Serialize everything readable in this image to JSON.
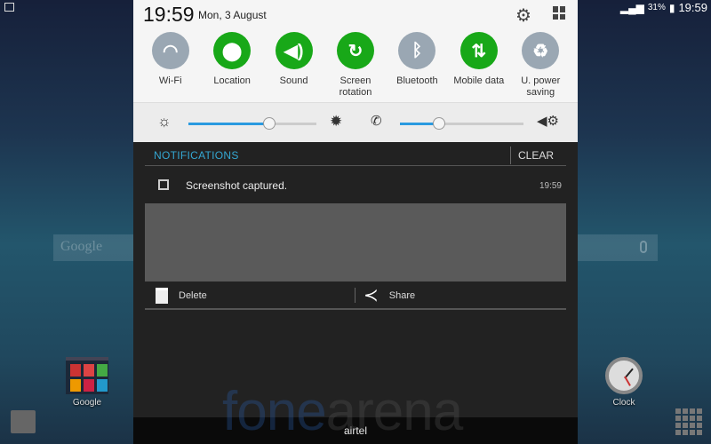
{
  "status_bar": {
    "battery": "31%",
    "time": "19:59"
  },
  "home": {
    "search_placeholder": "Google",
    "folder_label": "Google",
    "clock_label": "Clock"
  },
  "panel": {
    "time": "19:59",
    "date": "Mon, 3 August",
    "toggles": [
      {
        "label": "Wi-Fi",
        "icon": "wifi-icon",
        "on": false
      },
      {
        "label": "Location",
        "icon": "location-icon",
        "on": true
      },
      {
        "label": "Sound",
        "icon": "sound-icon",
        "on": true
      },
      {
        "label": "Screen rotation",
        "icon": "screen-rotation-icon",
        "on": true
      },
      {
        "label": "Bluetooth",
        "icon": "bluetooth-icon",
        "on": false
      },
      {
        "label": "Mobile data",
        "icon": "mobile-data-icon",
        "on": true
      },
      {
        "label": "U. power saving",
        "icon": "power-saving-icon",
        "on": false
      }
    ],
    "brightness_level": 0.63,
    "volume_level": 0.32,
    "colors": {
      "on": "#18a818",
      "off": "#9aa7b3",
      "accent": "#34a7d2"
    }
  },
  "notifications": {
    "header": "NOTIFICATIONS",
    "clear": "CLEAR",
    "item": {
      "text": "Screenshot captured.",
      "time": "19:59",
      "actions": [
        "Delete",
        "Share"
      ]
    }
  },
  "carrier": "airtel",
  "watermark": "fonearena"
}
